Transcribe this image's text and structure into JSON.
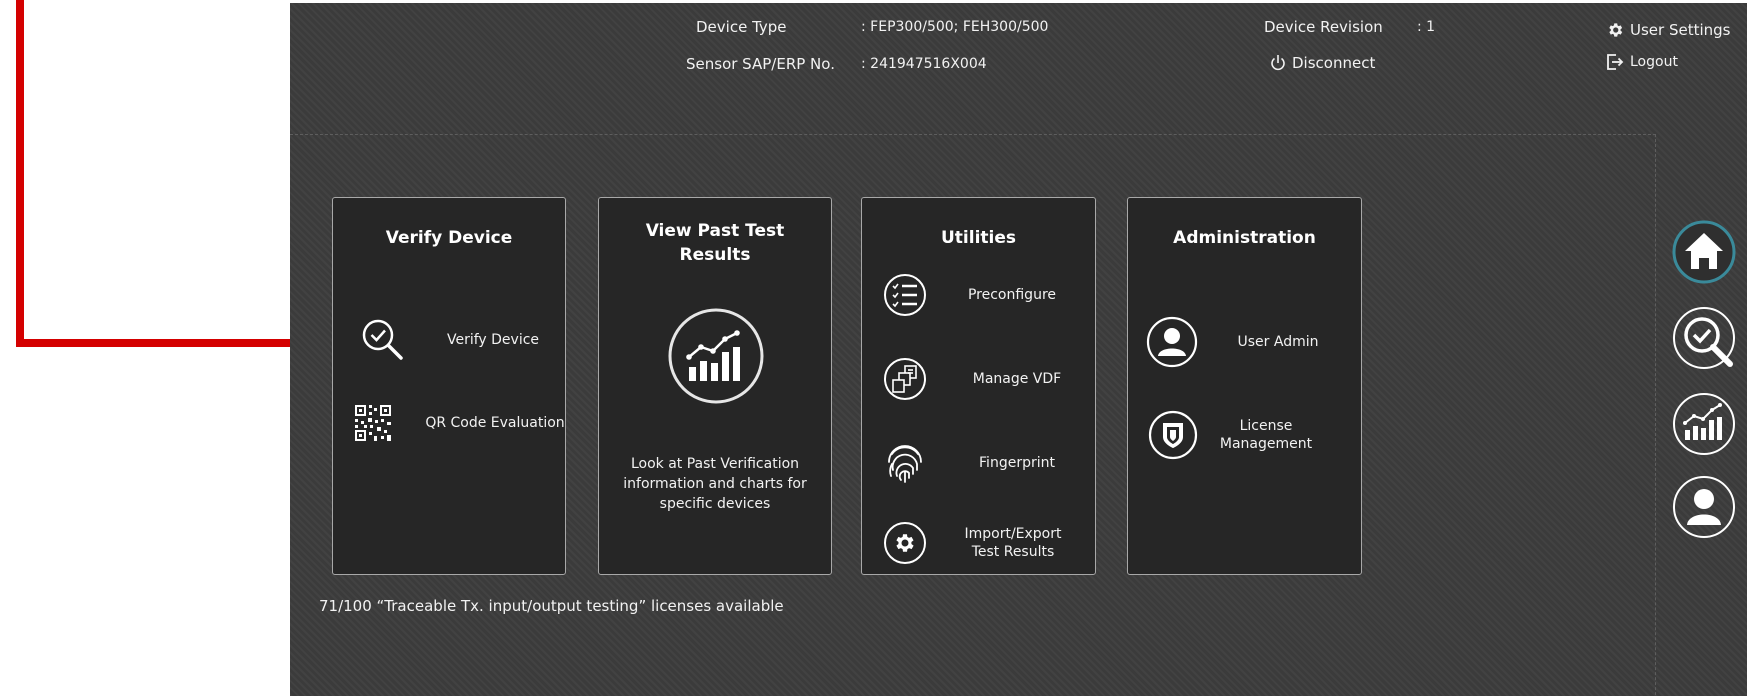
{
  "header": {
    "device_type_label": "Device Type",
    "device_type_value": ": FEP300/500; FEH300/500",
    "sensor_label": "Sensor SAP/ERP No.",
    "sensor_value": ": 241947516X004",
    "device_revision_label": "Device Revision",
    "device_revision_value": ": 1",
    "disconnect_label": "Disconnect",
    "user_settings_label": "User Settings",
    "logout_label": "Logout"
  },
  "cards": {
    "verify": {
      "title": "Verify Device",
      "items": [
        {
          "label": "Verify Device",
          "icon": "magnifier-check-icon"
        },
        {
          "label": "QR Code Evaluation",
          "icon": "qr-code-icon"
        }
      ]
    },
    "past": {
      "title_line1": "View Past Test",
      "title_line2": "Results",
      "icon": "bar-chart-trend-icon",
      "description_line1": "Look at Past Verification",
      "description_line2": "information and charts for",
      "description_line3": "specific devices"
    },
    "utilities": {
      "title": "Utilities",
      "items": [
        {
          "label": "Preconfigure",
          "icon": "checklist-icon"
        },
        {
          "label": "Manage VDF",
          "icon": "manage-files-icon"
        },
        {
          "label": "Fingerprint",
          "icon": "fingerprint-icon"
        },
        {
          "label_line1": "Import/Export",
          "label_line2": "Test Results",
          "icon": "gear-icon"
        }
      ]
    },
    "admin": {
      "title": "Administration",
      "items": [
        {
          "label": "User Admin",
          "icon": "user-icon"
        },
        {
          "label_line1": "License",
          "label_line2": "Management",
          "icon": "shield-icon"
        }
      ]
    }
  },
  "footer": {
    "licenses_text": "71/100 “Traceable Tx. input/output testing” licenses available"
  },
  "sidebar": {
    "items": [
      {
        "icon": "home-icon",
        "active": true
      },
      {
        "icon": "verify-icon",
        "active": false
      },
      {
        "icon": "chart-icon",
        "active": false
      },
      {
        "icon": "user-icon",
        "active": false
      }
    ]
  },
  "colors": {
    "background": "#3b3b3b",
    "card": "#262626",
    "card_border": "#a8a8a8",
    "accent_teal": "#3a8a9a",
    "annotation_red": "#d40000"
  }
}
